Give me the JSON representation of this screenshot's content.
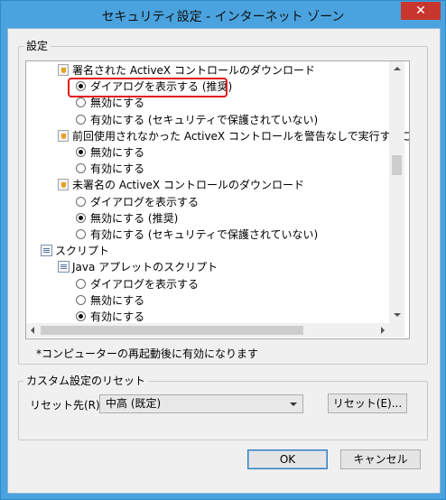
{
  "window": {
    "title": "セキュリティ設定 - インターネット ゾーン",
    "close_glyph": "✕"
  },
  "settings_group": {
    "label": "設定"
  },
  "settings_list": [
    {
      "kind": "category",
      "icon": "shield-setting-icon",
      "text": "署名された ActiveX コントロールのダウンロード"
    },
    {
      "kind": "option",
      "selected": true,
      "text": "ダイアログを表示する (推奨)"
    },
    {
      "kind": "option",
      "selected": false,
      "text": "無効にする"
    },
    {
      "kind": "option",
      "selected": false,
      "text": "有効にする (セキュリティで保護されていない)"
    },
    {
      "kind": "category",
      "icon": "shield-setting-icon",
      "text": "前回使用されなかった ActiveX コントロールを警告なしで実行することを許"
    },
    {
      "kind": "option",
      "selected": true,
      "text": "無効にする"
    },
    {
      "kind": "option",
      "selected": false,
      "text": "有効にする"
    },
    {
      "kind": "category",
      "icon": "shield-setting-icon",
      "text": "未署名の ActiveX コントロールのダウンロード"
    },
    {
      "kind": "option",
      "selected": false,
      "text": "ダイアログを表示する"
    },
    {
      "kind": "option",
      "selected": true,
      "text": "無効にする (推奨)"
    },
    {
      "kind": "option",
      "selected": false,
      "text": "有効にする (セキュリティで保護されていない)"
    },
    {
      "kind": "section",
      "icon": "script-icon",
      "text": "スクリプト"
    },
    {
      "kind": "subcategory",
      "icon": "script-icon",
      "text": "Java アプレットのスクリプト"
    },
    {
      "kind": "option",
      "selected": false,
      "text": "ダイアログを表示する"
    },
    {
      "kind": "option",
      "selected": false,
      "text": "無効にする"
    },
    {
      "kind": "option",
      "selected": true,
      "text": "有効にする"
    }
  ],
  "note": "*コンピューターの再起動後に有効になります",
  "reset_group": {
    "label": "カスタム設定のリセット",
    "reset_to_label": "リセット先(R):",
    "reset_to_value": "中高 (既定)",
    "reset_button": "リセット(E)..."
  },
  "footer": {
    "ok": "OK",
    "cancel": "キャンセル"
  },
  "colors": {
    "titlebar": "#4aa3de",
    "close": "#c7372f",
    "highlight": "#e1171e"
  }
}
